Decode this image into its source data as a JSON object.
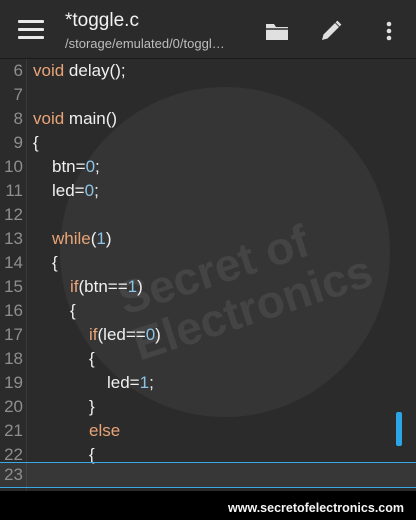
{
  "header": {
    "title": "*toggle.c",
    "path": "/storage/emulated/0/toggl…",
    "icons": [
      "menu-icon",
      "folder-icon",
      "pencil-icon",
      "more-vert-icon"
    ]
  },
  "editor": {
    "lines": [
      {
        "number": "6",
        "text": "void delay();"
      },
      {
        "number": "7",
        "text": ""
      },
      {
        "number": "8",
        "text": "void main()"
      },
      {
        "number": "9",
        "text": "{"
      },
      {
        "number": "10",
        "text": "btn=0;"
      },
      {
        "number": "11",
        "text": "led=0;"
      },
      {
        "number": "12",
        "text": ""
      },
      {
        "number": "13",
        "text": "while(1)"
      },
      {
        "number": "14",
        "text": "{"
      },
      {
        "number": "15",
        "text": "if(btn==1)"
      },
      {
        "number": "16",
        "text": "{"
      },
      {
        "number": "17",
        "text": "if(led==0)"
      },
      {
        "number": "18",
        "text": "{"
      },
      {
        "number": "19",
        "text": "led=1;"
      },
      {
        "number": "20",
        "text": "}"
      },
      {
        "number": "21",
        "text": "else"
      },
      {
        "number": "22",
        "text": "{"
      },
      {
        "number": "23",
        "text": ""
      }
    ],
    "current_line": "23",
    "colors": {
      "keyword": "#e8a477",
      "number": "#8cc4e8",
      "text": "#f0f0f0",
      "line_number": "#8e8e8e",
      "accent": "#37a9e6"
    }
  },
  "watermark": {
    "text": "Secret of Electronics"
  },
  "footer": {
    "site": "www.secretofelectronics.com"
  }
}
